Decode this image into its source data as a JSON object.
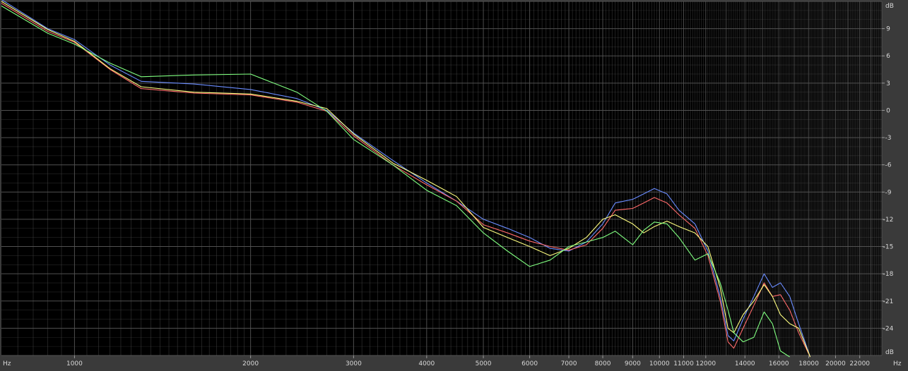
{
  "chart_data": {
    "type": "line",
    "x_scale": "log",
    "x_unit": "Hz",
    "y_unit": "dB",
    "xlim": [
      750,
      24000
    ],
    "ylim": [
      -27,
      12
    ],
    "grid": true,
    "background": "#000000",
    "grid_color": "#555555",
    "x_tick_labels": [
      {
        "value": 1000,
        "label": "1000"
      },
      {
        "value": 2000,
        "label": "2000"
      },
      {
        "value": 3000,
        "label": "3000"
      },
      {
        "value": 4000,
        "label": "4000"
      },
      {
        "value": 5000,
        "label": "5000"
      },
      {
        "value": 6000,
        "label": "6000"
      },
      {
        "value": 7000,
        "label": "7000"
      },
      {
        "value": 8000,
        "label": "8000"
      },
      {
        "value": 9000,
        "label": "9000"
      },
      {
        "value": 10000,
        "label": "10000"
      },
      {
        "value": 11000,
        "label": "11000"
      },
      {
        "value": 12000,
        "label": "12000"
      },
      {
        "value": 14000,
        "label": "14000"
      },
      {
        "value": 16000,
        "label": "16000"
      },
      {
        "value": 18000,
        "label": "18000"
      },
      {
        "value": 20000,
        "label": "20000"
      },
      {
        "value": 22000,
        "label": "22000"
      }
    ],
    "y_tick_labels": [
      {
        "value": 9,
        "label": "9"
      },
      {
        "value": 6,
        "label": "6"
      },
      {
        "value": 3,
        "label": "3"
      },
      {
        "value": 0,
        "label": "0"
      },
      {
        "value": -3,
        "label": "-3"
      },
      {
        "value": -6,
        "label": "-6"
      },
      {
        "value": -9,
        "label": "-9"
      },
      {
        "value": -12,
        "label": "-12"
      },
      {
        "value": -15,
        "label": "-15"
      },
      {
        "value": -18,
        "label": "-18"
      },
      {
        "value": -21,
        "label": "-21"
      },
      {
        "value": -24,
        "label": "-24"
      }
    ],
    "x_unit_labels": {
      "left": "Hz",
      "right": "Hz"
    },
    "y_unit_labels": {
      "top": "dB",
      "bottom": "dB"
    },
    "series": [
      {
        "color": "#6a8cff",
        "points": [
          [
            750,
            12.2
          ],
          [
            900,
            9.0
          ],
          [
            1000,
            7.8
          ],
          [
            1150,
            5.0
          ],
          [
            1300,
            3.2
          ],
          [
            1600,
            2.9
          ],
          [
            2000,
            2.3
          ],
          [
            2400,
            1.3
          ],
          [
            2700,
            0.0
          ],
          [
            3000,
            -2.5
          ],
          [
            3500,
            -5.5
          ],
          [
            4000,
            -8.0
          ],
          [
            4500,
            -10.0
          ],
          [
            5000,
            -12.0
          ],
          [
            5500,
            -13.0
          ],
          [
            6000,
            -14.0
          ],
          [
            6500,
            -15.2
          ],
          [
            7000,
            -15.5
          ],
          [
            7500,
            -14.5
          ],
          [
            8000,
            -12.5
          ],
          [
            8400,
            -10.2
          ],
          [
            9000,
            -9.8
          ],
          [
            9400,
            -9.2
          ],
          [
            9800,
            -8.6
          ],
          [
            10300,
            -9.2
          ],
          [
            10800,
            -11.0
          ],
          [
            11500,
            -12.5
          ],
          [
            12100,
            -15.5
          ],
          [
            12700,
            -20.5
          ],
          [
            13100,
            -24.8
          ],
          [
            13400,
            -25.4
          ],
          [
            13900,
            -23.0
          ],
          [
            14500,
            -20.5
          ],
          [
            15100,
            -18.0
          ],
          [
            15600,
            -19.5
          ],
          [
            16100,
            -19.0
          ],
          [
            16700,
            -20.5
          ],
          [
            17300,
            -23.5
          ],
          [
            18100,
            -27.5
          ]
        ]
      },
      {
        "color": "#ff6a6a",
        "points": [
          [
            750,
            11.8
          ],
          [
            900,
            8.7
          ],
          [
            1000,
            7.5
          ],
          [
            1150,
            4.5
          ],
          [
            1300,
            2.4
          ],
          [
            1600,
            1.9
          ],
          [
            2000,
            1.7
          ],
          [
            2400,
            0.9
          ],
          [
            2700,
            -0.1
          ],
          [
            3000,
            -2.8
          ],
          [
            3500,
            -6.0
          ],
          [
            4000,
            -8.2
          ],
          [
            4500,
            -10.0
          ],
          [
            5000,
            -12.6
          ],
          [
            5500,
            -13.5
          ],
          [
            6000,
            -14.4
          ],
          [
            6500,
            -15.0
          ],
          [
            7000,
            -15.4
          ],
          [
            7500,
            -14.8
          ],
          [
            8000,
            -13.0
          ],
          [
            8400,
            -11.0
          ],
          [
            9000,
            -10.8
          ],
          [
            9400,
            -10.2
          ],
          [
            9800,
            -9.6
          ],
          [
            10300,
            -10.2
          ],
          [
            10800,
            -11.5
          ],
          [
            11500,
            -13.0
          ],
          [
            12100,
            -16.0
          ],
          [
            12700,
            -21.0
          ],
          [
            13100,
            -25.5
          ],
          [
            13400,
            -26.2
          ],
          [
            13900,
            -24.0
          ],
          [
            14500,
            -21.5
          ],
          [
            15100,
            -19.0
          ],
          [
            15600,
            -20.5
          ],
          [
            16100,
            -20.3
          ],
          [
            16700,
            -22.0
          ],
          [
            17300,
            -24.5
          ],
          [
            18100,
            -27.5
          ]
        ]
      },
      {
        "color": "#ffff80",
        "points": [
          [
            750,
            12.0
          ],
          [
            900,
            8.9
          ],
          [
            1000,
            7.6
          ],
          [
            1150,
            4.6
          ],
          [
            1300,
            2.6
          ],
          [
            1600,
            2.0
          ],
          [
            2000,
            1.8
          ],
          [
            2400,
            1.0
          ],
          [
            2700,
            0.2
          ],
          [
            3000,
            -2.6
          ],
          [
            3500,
            -5.8
          ],
          [
            4000,
            -7.7
          ],
          [
            4500,
            -9.5
          ],
          [
            5000,
            -12.9
          ],
          [
            5500,
            -14.0
          ],
          [
            6000,
            -15.0
          ],
          [
            6500,
            -16.0
          ],
          [
            7000,
            -15.2
          ],
          [
            7500,
            -14.0
          ],
          [
            8000,
            -12.0
          ],
          [
            8400,
            -11.5
          ],
          [
            9000,
            -12.5
          ],
          [
            9400,
            -13.5
          ],
          [
            9800,
            -12.8
          ],
          [
            10300,
            -12.2
          ],
          [
            10800,
            -12.8
          ],
          [
            11500,
            -13.5
          ],
          [
            12100,
            -15.0
          ],
          [
            12700,
            -19.5
          ],
          [
            13100,
            -24.0
          ],
          [
            13400,
            -24.5
          ],
          [
            13900,
            -22.5
          ],
          [
            14500,
            -21.0
          ],
          [
            15100,
            -19.2
          ],
          [
            15600,
            -20.5
          ],
          [
            16100,
            -22.5
          ],
          [
            16700,
            -23.5
          ],
          [
            17300,
            -24.0
          ],
          [
            18100,
            -27.5
          ]
        ]
      },
      {
        "color": "#80ff80",
        "points": [
          [
            750,
            11.5
          ],
          [
            900,
            8.5
          ],
          [
            1000,
            7.3
          ],
          [
            1150,
            5.2
          ],
          [
            1300,
            3.7
          ],
          [
            1600,
            3.9
          ],
          [
            2000,
            4.0
          ],
          [
            2400,
            2.0
          ],
          [
            2700,
            -0.1
          ],
          [
            3000,
            -3.2
          ],
          [
            3500,
            -6.0
          ],
          [
            4000,
            -8.8
          ],
          [
            4500,
            -10.5
          ],
          [
            5000,
            -13.5
          ],
          [
            5500,
            -15.5
          ],
          [
            6000,
            -17.2
          ],
          [
            6500,
            -16.5
          ],
          [
            7000,
            -15.0
          ],
          [
            7500,
            -14.5
          ],
          [
            8000,
            -14.0
          ],
          [
            8400,
            -13.3
          ],
          [
            9000,
            -14.8
          ],
          [
            9400,
            -13.2
          ],
          [
            9800,
            -12.3
          ],
          [
            10300,
            -12.5
          ],
          [
            10800,
            -14.0
          ],
          [
            11500,
            -16.5
          ],
          [
            12100,
            -15.8
          ],
          [
            12700,
            -19.0
          ],
          [
            13100,
            -22.0
          ],
          [
            13400,
            -24.5
          ],
          [
            13900,
            -25.5
          ],
          [
            14500,
            -25.0
          ],
          [
            15100,
            -22.2
          ],
          [
            15600,
            -23.5
          ],
          [
            16100,
            -26.5
          ],
          [
            16700,
            -28.0
          ]
        ]
      }
    ]
  }
}
